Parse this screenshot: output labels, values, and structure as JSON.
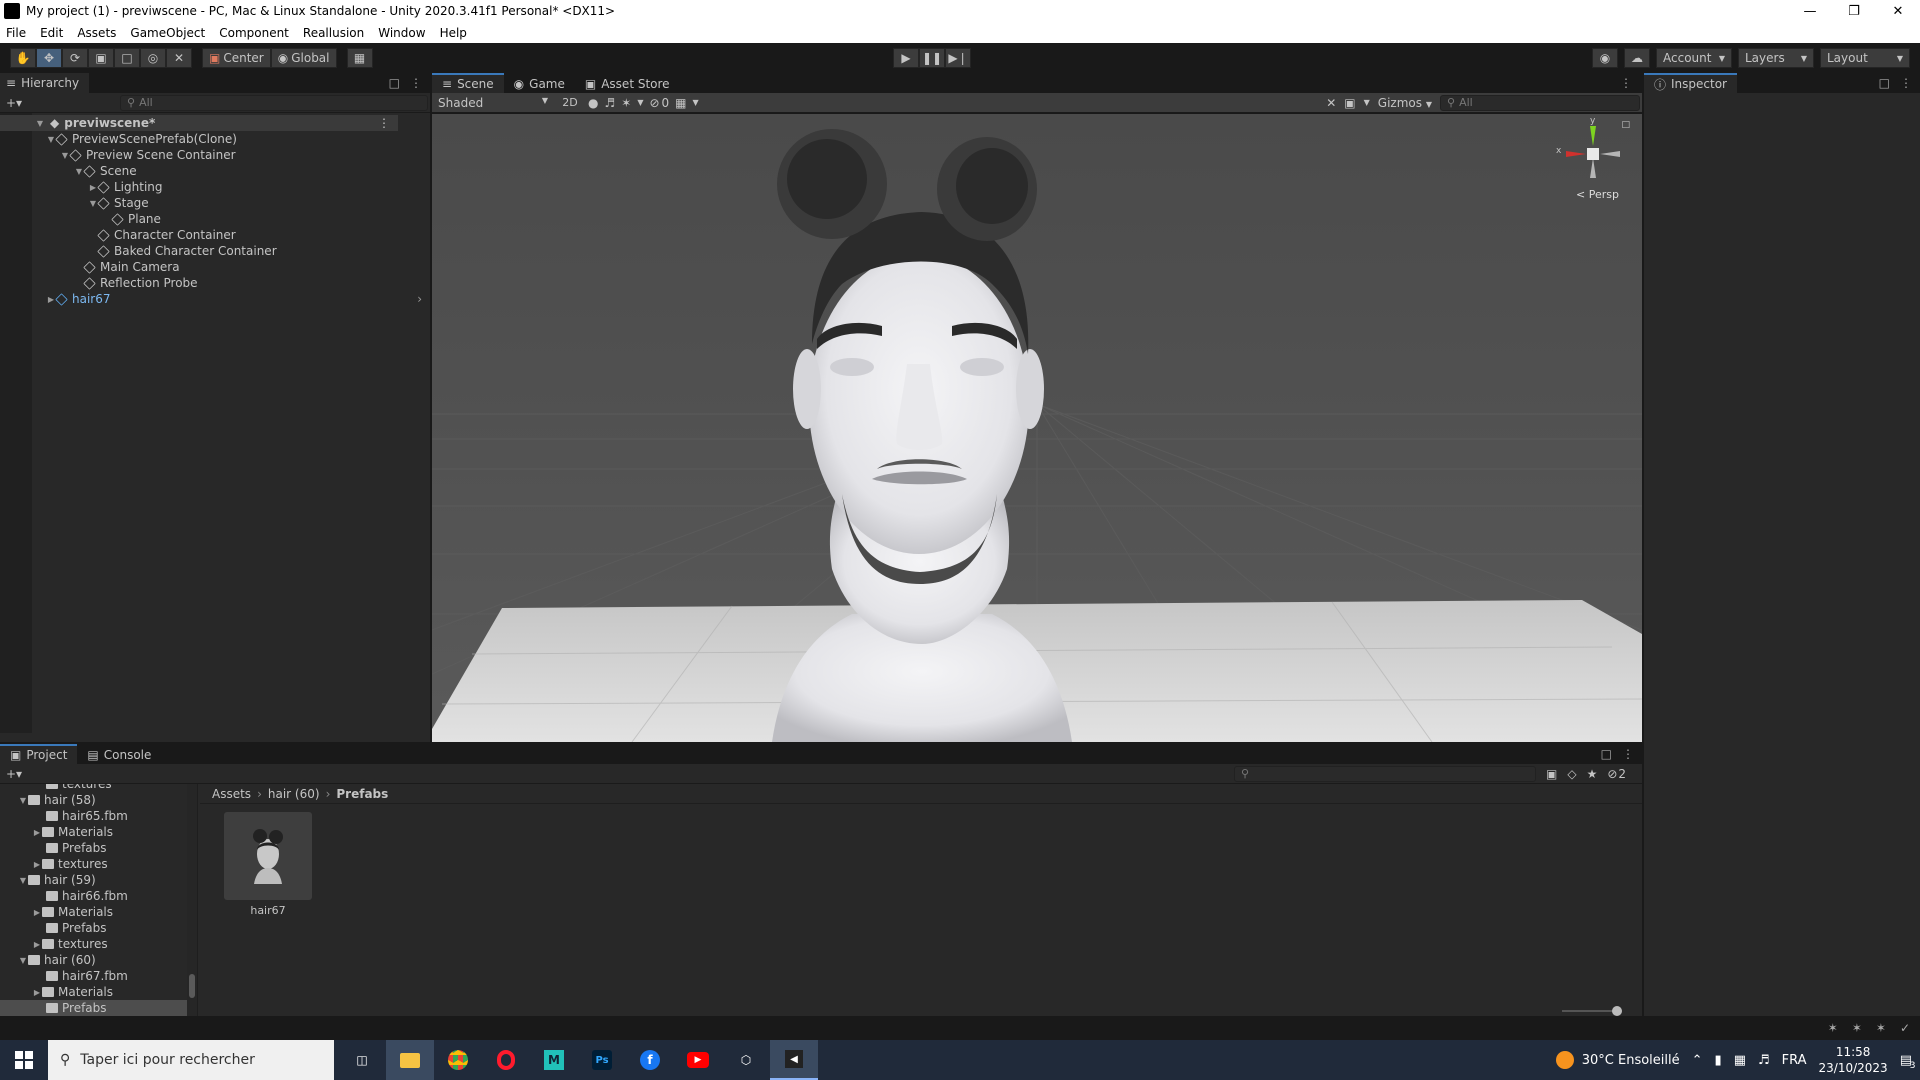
{
  "window": {
    "title": "My project (1) - previwscene - PC, Mac & Linux Standalone - Unity 2020.3.41f1 Personal* <DX11>"
  },
  "menu": [
    "File",
    "Edit",
    "Assets",
    "GameObject",
    "Component",
    "Reallusion",
    "Window",
    "Help"
  ],
  "toolbar": {
    "center_label": "Center",
    "global_label": "Global",
    "account_label": "Account",
    "layers_label": "Layers",
    "layout_label": "Layout"
  },
  "hierarchy": {
    "tab_label": "Hierarchy",
    "search_placeholder": "All",
    "items": [
      {
        "label": "previwscene*"
      },
      {
        "label": "PreviewScenePrefab(Clone)"
      },
      {
        "label": "Preview Scene Container"
      },
      {
        "label": "Scene"
      },
      {
        "label": "Lighting"
      },
      {
        "label": "Stage"
      },
      {
        "label": "Plane"
      },
      {
        "label": "Character Container"
      },
      {
        "label": "Baked Character Container"
      },
      {
        "label": "Main Camera"
      },
      {
        "label": "Reflection Probe"
      },
      {
        "label": "hair67"
      }
    ]
  },
  "scene": {
    "tabs": [
      {
        "label": "Scene"
      },
      {
        "label": "Game"
      },
      {
        "label": "Asset Store"
      }
    ],
    "shading": "Shaded",
    "mode_2d": "2D",
    "hidden_count": "0",
    "gizmos_label": "Gizmos",
    "search_placeholder": "All",
    "gizmo": {
      "y": "y",
      "x": "x",
      "persp": "< Persp"
    }
  },
  "inspector": {
    "tab_label": "Inspector"
  },
  "project": {
    "tabs": [
      {
        "label": "Project"
      },
      {
        "label": "Console"
      }
    ],
    "hidden_count": "2",
    "breadcrumb": [
      "Assets",
      "hair (60)",
      "Prefabs"
    ],
    "tree": [
      {
        "label": "textures"
      },
      {
        "label": "hair (58)"
      },
      {
        "label": "hair65.fbm"
      },
      {
        "label": "Materials"
      },
      {
        "label": "Prefabs"
      },
      {
        "label": "textures"
      },
      {
        "label": "hair (59)"
      },
      {
        "label": "hair66.fbm"
      },
      {
        "label": "Materials"
      },
      {
        "label": "Prefabs"
      },
      {
        "label": "textures"
      },
      {
        "label": "hair (60)"
      },
      {
        "label": "hair67.fbm"
      },
      {
        "label": "Materials"
      },
      {
        "label": "Prefabs"
      }
    ],
    "asset": {
      "label": "hair67"
    }
  },
  "taskbar": {
    "search_placeholder": "Taper ici pour rechercher",
    "weather": "30°C  Ensoleillé",
    "lang": "FRA",
    "time": "11:58",
    "date": "23/10/2023",
    "notif_count": "3"
  }
}
